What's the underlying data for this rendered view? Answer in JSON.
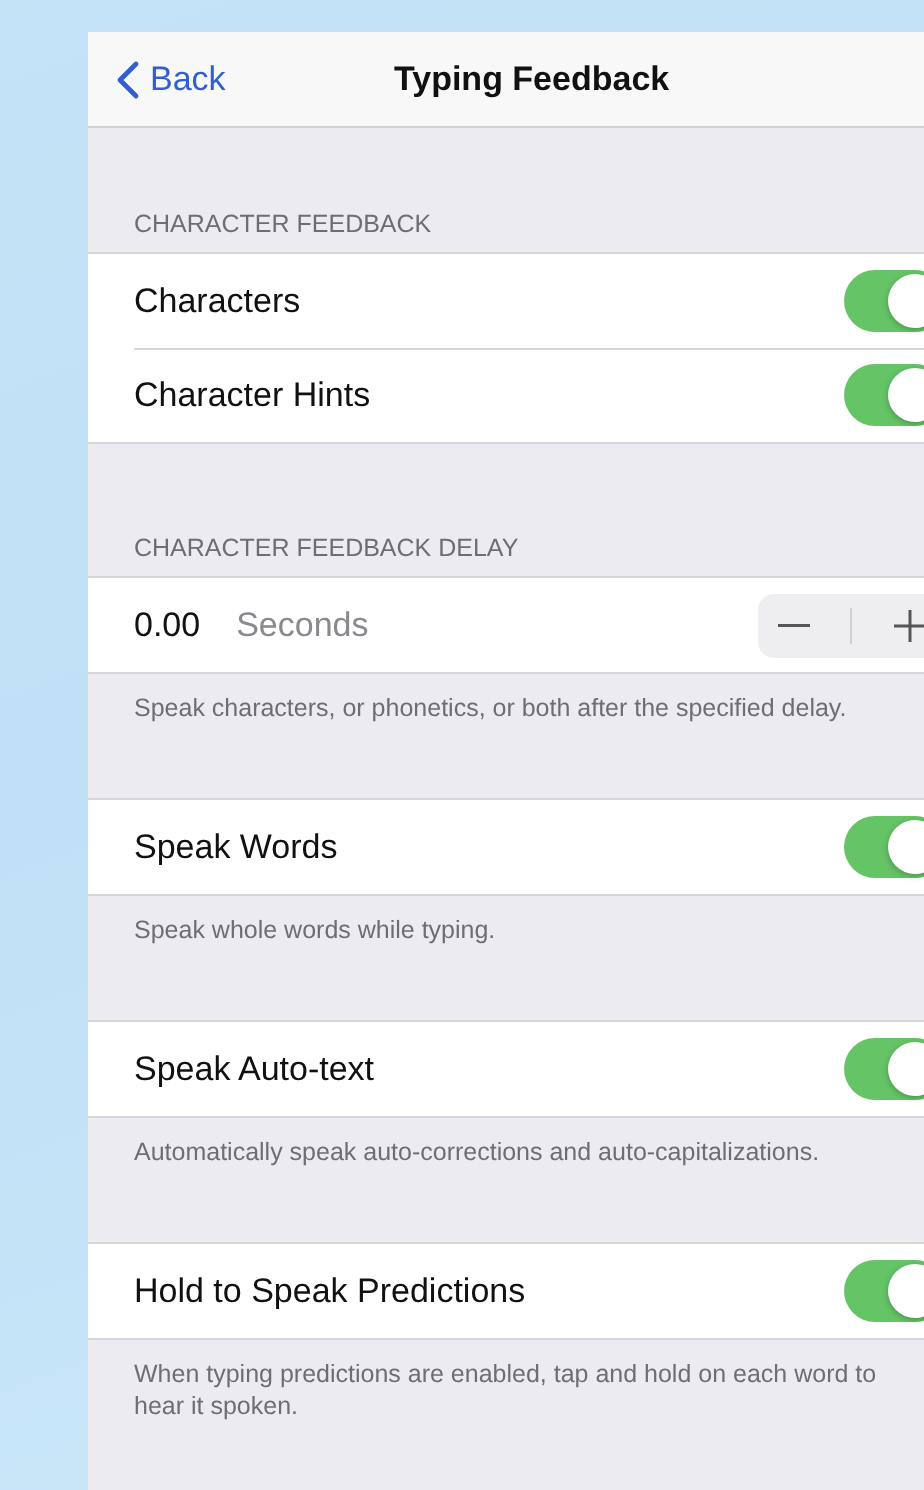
{
  "nav": {
    "back": "Back",
    "title": "Typing Feedback"
  },
  "sections": [
    {
      "header": "CHARACTER FEEDBACK",
      "rows": [
        {
          "kind": "toggle",
          "label": "Characters",
          "on": true
        },
        {
          "kind": "toggle",
          "label": "Character Hints",
          "on": true
        }
      ]
    },
    {
      "header": "CHARACTER FEEDBACK DELAY",
      "rows": [
        {
          "kind": "stepper",
          "value": "0.00",
          "unit": "Seconds"
        }
      ],
      "footer": "Speak characters, or phonetics, or both after the specified delay."
    },
    {
      "rows": [
        {
          "kind": "toggle",
          "label": "Speak Words",
          "on": true
        }
      ],
      "footer": "Speak whole words while typing."
    },
    {
      "rows": [
        {
          "kind": "toggle",
          "label": "Speak Auto-text",
          "on": true
        }
      ],
      "footer": "Automatically speak auto-corrections and auto-capitalizations."
    },
    {
      "rows": [
        {
          "kind": "toggle",
          "label": "Hold to Speak Predictions",
          "on": true
        }
      ],
      "footer": "When typing predictions are enabled, tap and hold on each word to hear it spoken."
    }
  ]
}
